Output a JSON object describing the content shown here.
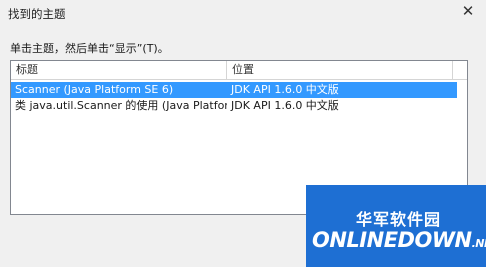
{
  "window": {
    "title": "找到的主题",
    "close_glyph": "✕"
  },
  "instruction": "单击主题，然后单击“显示”(T)。",
  "table": {
    "columns": [
      "标题",
      "位置"
    ],
    "rows": [
      {
        "title": "Scanner (Java Platform SE 6)",
        "location": "JDK API 1.6.0 中文版",
        "selected": true
      },
      {
        "title": "类 java.util.Scanner 的使用 (Java Platfor...",
        "location": "JDK API 1.6.0 中文版",
        "selected": false
      }
    ]
  },
  "watermark": {
    "chinese": "华军软件园",
    "english": "ONLINEDOWN",
    "suffix": ".NET",
    "color": "#1e6fd3"
  }
}
